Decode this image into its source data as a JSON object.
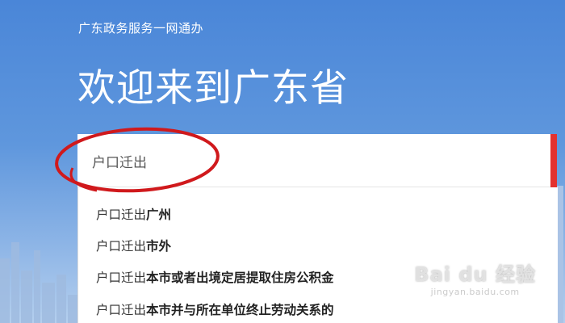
{
  "header": {
    "site_name": "广东政务服务一网通办",
    "welcome": "欢迎来到广东省"
  },
  "search": {
    "value": "户口迁出"
  },
  "suggestions": [
    {
      "match": "户口迁出",
      "rest": "广州"
    },
    {
      "match": "户口迁出",
      "rest": "市外"
    },
    {
      "match": "户口迁出",
      "rest": "本市或者出境定居提取住房公积金"
    },
    {
      "match": "户口迁出",
      "rest": "本市并与所在单位终止劳动关系的"
    }
  ],
  "watermark": {
    "brand": "Bai du 经验",
    "url": "jingyan.baidu.com"
  },
  "colors": {
    "accent": "#e3322f",
    "annotation": "#d0191c"
  }
}
